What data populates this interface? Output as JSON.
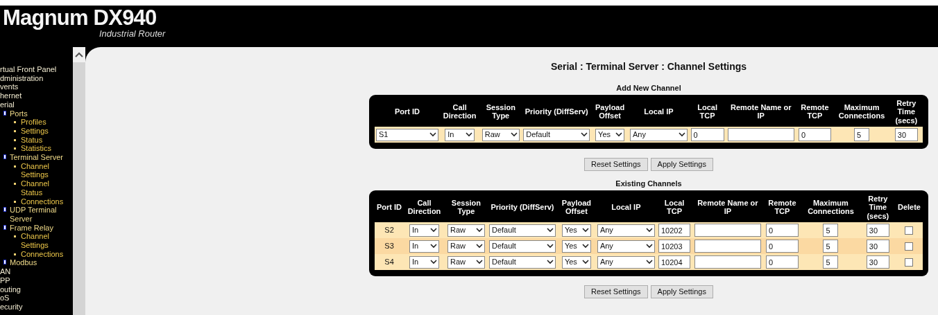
{
  "header": {
    "title": "Magnum DX940",
    "subtitle": "Industrial Router"
  },
  "sidebar": {
    "items": [
      {
        "label": "rtual Front Panel"
      },
      {
        "label": "dministration"
      },
      {
        "label": "vents"
      },
      {
        "label": "hernet"
      },
      {
        "label": "erial",
        "children": [
          {
            "label": "Ports",
            "children": [
              {
                "label": "Profiles"
              },
              {
                "label": "Settings"
              },
              {
                "label": "Status"
              },
              {
                "label": "Statistics"
              }
            ]
          },
          {
            "label": "Terminal Server",
            "children": [
              {
                "label": "Channel Settings"
              },
              {
                "label": "Channel Status"
              },
              {
                "label": "Connections"
              }
            ]
          },
          {
            "label": "UDP Terminal Server"
          },
          {
            "label": "Frame Relay",
            "children": [
              {
                "label": "Channel Settings"
              },
              {
                "label": "Connections"
              }
            ]
          },
          {
            "label": "Modbus"
          }
        ]
      },
      {
        "label": "AN"
      },
      {
        "label": "PP"
      },
      {
        "label": "outing"
      },
      {
        "label": "oS"
      },
      {
        "label": "ecurity"
      }
    ]
  },
  "page_title": "Serial : Terminal Server : Channel Settings",
  "add_channel": {
    "title": "Add New Channel",
    "columns": [
      "Port ID",
      "Call Direction",
      "Session Type",
      "Priority (DiffServ)",
      "Payload Offset",
      "Local IP",
      "Local TCP",
      "Remote Name or IP",
      "Remote TCP",
      "Maximum Connections",
      "Retry Time (secs)"
    ],
    "row": {
      "port_id": "S1",
      "call_direction": "In",
      "session_type": "Raw",
      "priority": "Default",
      "payload_offset": "Yes",
      "local_ip": "Any",
      "local_tcp": "0",
      "remote_tcp": "0",
      "max_connections": "5",
      "retry_time": "30"
    },
    "buttons": [
      "Reset Settings",
      "Apply Settings"
    ]
  },
  "existing_channels": {
    "title": "Existing Channels",
    "columns": [
      "Port ID",
      "Call Direction",
      "Session Type",
      "Priority (DiffServ)",
      "Payload Offset",
      "Local IP",
      "Local TCP",
      "Remote Name or IP",
      "Remote TCP",
      "Maximum Connections",
      "Retry Time (secs)",
      "Delete"
    ],
    "rows": [
      {
        "port_id": "S2",
        "call_direction": "In",
        "session_type": "Raw",
        "priority": "Default",
        "payload_offset": "Yes",
        "local_ip": "Any",
        "local_tcp": "10202",
        "remote_tcp": "0",
        "max_connections": "5",
        "retry_time": "30",
        "delete": false
      },
      {
        "port_id": "S3",
        "call_direction": "In",
        "session_type": "Raw",
        "priority": "Default",
        "payload_offset": "Yes",
        "local_ip": "Any",
        "local_tcp": "10203",
        "remote_tcp": "0",
        "max_connections": "5",
        "retry_time": "30",
        "delete": false
      },
      {
        "port_id": "S4",
        "call_direction": "In",
        "session_type": "Raw",
        "priority": "Default",
        "payload_offset": "Yes",
        "local_ip": "Any",
        "local_tcp": "10204",
        "remote_tcp": "0",
        "max_connections": "5",
        "retry_time": "30",
        "delete": false
      }
    ],
    "buttons": [
      "Reset Settings",
      "Apply Settings"
    ]
  }
}
